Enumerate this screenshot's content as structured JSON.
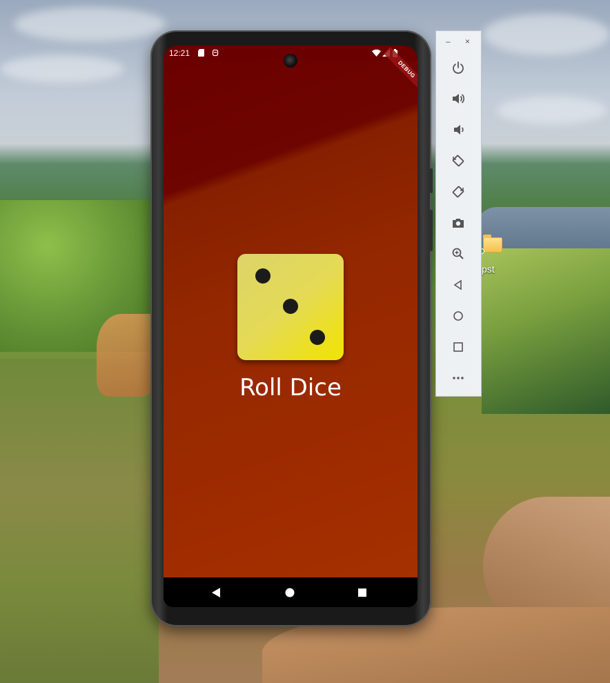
{
  "desktop": {
    "shortcut_label": "pst"
  },
  "phone": {
    "status_bar": {
      "time": "12:21",
      "left_icons": [
        "sd-card-icon",
        "notification-icon"
      ],
      "right_icons": [
        "wifi-icon",
        "cellular-icon",
        "battery-icon"
      ]
    },
    "debug_banner": "DEBUG",
    "app": {
      "dice_face": 3,
      "dice_color": "#e6dc4a",
      "background_color": "#9c2a00",
      "roll_button_label": "Roll Dice"
    },
    "nav_bar": [
      "back",
      "home",
      "recents"
    ]
  },
  "emulator_toolbar": {
    "minimize": "–",
    "close": "×",
    "buttons": [
      "power",
      "volume-up",
      "volume-down",
      "rotate-left",
      "rotate-right",
      "screenshot",
      "zoom",
      "back",
      "home",
      "overview",
      "more"
    ]
  }
}
